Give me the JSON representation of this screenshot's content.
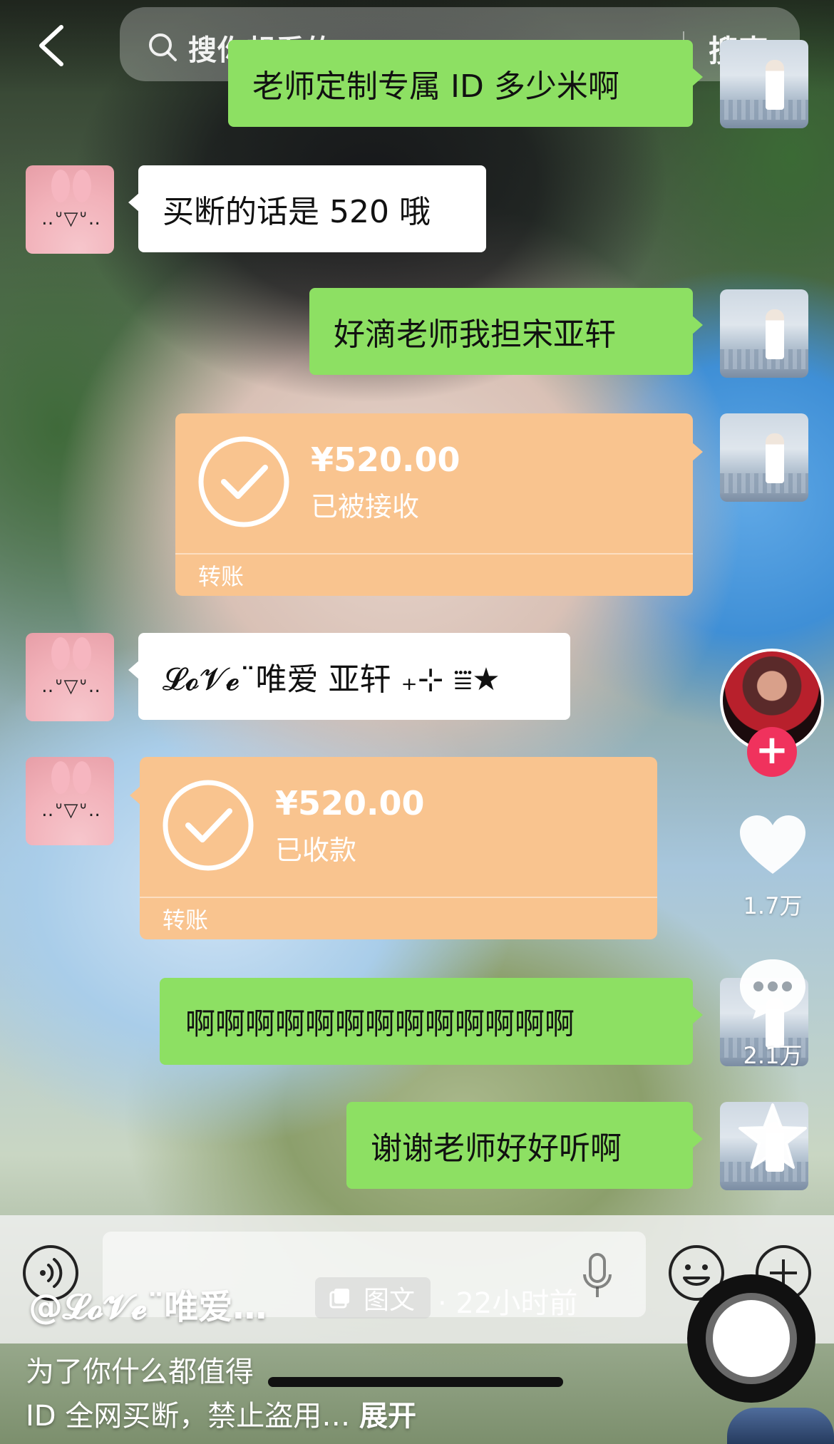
{
  "search": {
    "placeholder": "搜你想看的",
    "button_label": "搜索"
  },
  "messages": [
    {
      "side": "right",
      "type": "text",
      "text": "老师定制专属 ID 多少米啊"
    },
    {
      "side": "left",
      "type": "text",
      "text": "买断的话是 520 哦"
    },
    {
      "side": "right",
      "type": "text",
      "text": "好滴老师我担宋亚轩"
    },
    {
      "side": "right",
      "type": "transfer",
      "amount": "¥520.00",
      "status": "已被接收",
      "kind": "转账"
    },
    {
      "side": "left",
      "type": "text",
      "text": "𝓛𝓸𝓥𝓮¨唯爱 亚轩 ₊⊹ ⩸★"
    },
    {
      "side": "left",
      "type": "transfer",
      "amount": "¥520.00",
      "status": "已收款",
      "kind": "转账"
    },
    {
      "side": "right",
      "type": "text",
      "text": "啊啊啊啊啊啊啊啊啊啊啊啊啊"
    },
    {
      "side": "right",
      "type": "text",
      "text": "谢谢老师好好听啊"
    }
  ],
  "rail": {
    "like_count": "1.7万",
    "comment_count": "2.1万",
    "follow_label": "+"
  },
  "post": {
    "author": "@𝓛𝓸𝓥𝓮¨唯爱…",
    "type_badge": "图文",
    "time": "· 22小时前",
    "caption_line1": "为了你什么都值得",
    "caption_line2": "ID 全网买断，禁止盗用…",
    "expand_label": "展开"
  },
  "colors": {
    "bubble_green": "#8de063",
    "transfer_orange": "#f9c48f",
    "follow_red": "#f0325d"
  },
  "icons": [
    "back-icon",
    "search-icon",
    "check-circle-icon",
    "heart-icon",
    "comment-icon",
    "star-icon",
    "voice-icon",
    "mic-icon",
    "emoji-icon",
    "plus-icon",
    "doc-icon"
  ]
}
